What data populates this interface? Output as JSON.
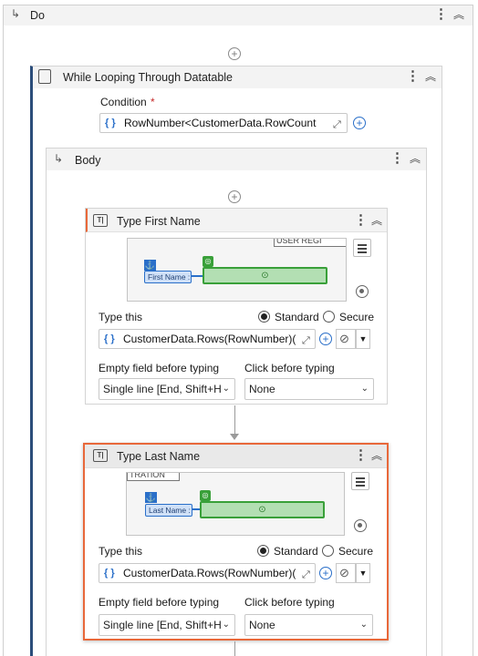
{
  "do_block": {
    "title": "Do"
  },
  "while_block": {
    "title": "While Looping Through Datatable",
    "condition_label": "Condition",
    "required_mark": "*",
    "condition_value": "RowNumber<CustomerData.RowCount"
  },
  "body_block": {
    "title": "Body"
  },
  "activities": [
    {
      "title": "Type First Name",
      "preview_field_label": "First Name :",
      "preview_banner": "USER REGI",
      "type_this_label": "Type this",
      "type_this_value": "CustomerData.Rows(RowNumber)(",
      "radio_standard": "Standard",
      "radio_secure": "Secure",
      "empty_field_label": "Empty field before typing",
      "empty_field_value": "Single line [End, Shift+H",
      "click_before_label": "Click before typing",
      "click_before_value": "None"
    },
    {
      "title": "Type Last Name",
      "preview_field_label": "Last Name :",
      "preview_banner": "TRATION",
      "type_this_label": "Type this",
      "type_this_value": "CustomerData.Rows(RowNumber)(",
      "radio_standard": "Standard",
      "radio_secure": "Secure",
      "empty_field_label": "Empty field before typing",
      "empty_field_value": "Single line [End, Shift+H",
      "click_before_label": "Click before typing",
      "click_before_value": "None"
    }
  ],
  "colors": {
    "selected_border": "#e8683a",
    "accent_blue": "#2a6fc9",
    "target_green": "#5fb95f"
  }
}
